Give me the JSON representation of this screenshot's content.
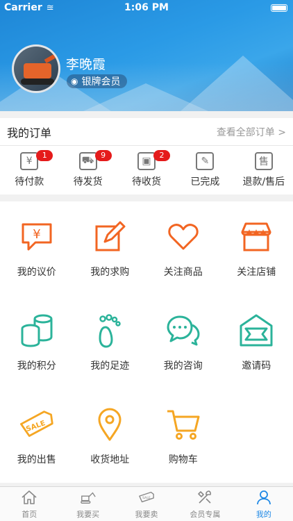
{
  "status": {
    "carrier": "Carrier",
    "time": "1:06 PM"
  },
  "profile": {
    "name": "李晚霞",
    "level": "银牌会员"
  },
  "orders": {
    "title": "我的订单",
    "view_all": "查看全部订单 >",
    "items": [
      {
        "label": "待付款",
        "count": "1",
        "icon": "pay-icon"
      },
      {
        "label": "待发货",
        "count": "9",
        "icon": "truck-icon"
      },
      {
        "label": "待收货",
        "count": "2",
        "icon": "package-icon"
      },
      {
        "label": "已完成",
        "count": "",
        "icon": "done-icon"
      },
      {
        "label": "退款/售后",
        "count": "",
        "icon": "after-sale-icon"
      }
    ]
  },
  "grid": [
    {
      "label": "我的议价",
      "icon": "price-chat-icon"
    },
    {
      "label": "我的求购",
      "icon": "purchase-request-icon"
    },
    {
      "label": "关注商品",
      "icon": "heart-icon"
    },
    {
      "label": "关注店铺",
      "icon": "store-icon"
    },
    {
      "label": "我的积分",
      "icon": "coins-icon"
    },
    {
      "label": "我的足迹",
      "icon": "footprint-icon"
    },
    {
      "label": "我的咨询",
      "icon": "consult-icon"
    },
    {
      "label": "邀请码",
      "icon": "invite-icon"
    },
    {
      "label": "我的出售",
      "icon": "sale-tag-icon"
    },
    {
      "label": "收货地址",
      "icon": "location-icon"
    },
    {
      "label": "购物车",
      "icon": "cart-icon"
    }
  ],
  "tabs": [
    {
      "label": "首页",
      "icon": "home-icon"
    },
    {
      "label": "我要买",
      "icon": "excavator-icon"
    },
    {
      "label": "我要卖",
      "icon": "sale-icon"
    },
    {
      "label": "会员专属",
      "icon": "tools-icon"
    },
    {
      "label": "我的",
      "icon": "user-icon"
    }
  ],
  "colors": {
    "accent": "#1e88e5",
    "orange": "#f26522",
    "teal": "#2bb39a",
    "yellow": "#f5a623",
    "badge_red": "#e51b1b"
  }
}
